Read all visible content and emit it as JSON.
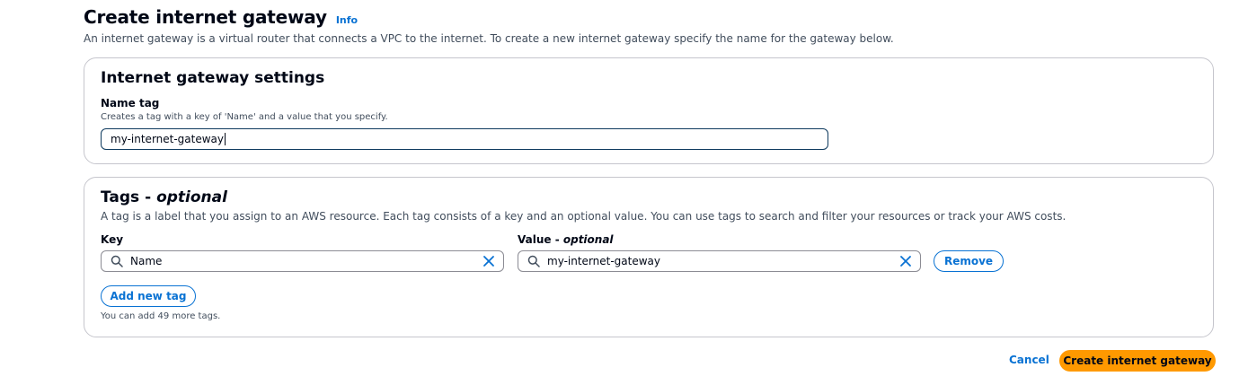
{
  "header": {
    "title": "Create internet gateway",
    "info_label": "Info",
    "description": "An internet gateway is a virtual router that connects a VPC to the internet. To create a new internet gateway specify the name for the gateway below."
  },
  "settings_panel": {
    "heading": "Internet gateway settings",
    "name_tag": {
      "label": "Name tag",
      "hint": "Creates a tag with a key of 'Name' and a value that you specify.",
      "value": "my-internet-gateway"
    }
  },
  "tags_panel": {
    "heading_prefix": "Tags - ",
    "heading_optional": "optional",
    "description": "A tag is a label that you assign to an AWS resource. Each tag consists of a key and an optional value. You can use tags to search and filter your resources or track your AWS costs.",
    "key_label": "Key",
    "value_label_prefix": "Value - ",
    "value_label_optional": "optional",
    "rows": [
      {
        "key": "Name",
        "value": "my-internet-gateway",
        "remove_label": "Remove"
      }
    ],
    "add_tag_label": "Add new tag",
    "limit_hint": "You can add 49 more tags."
  },
  "footer": {
    "cancel_label": "Cancel",
    "submit_label": "Create internet gateway"
  },
  "icons": {
    "search": "search-icon",
    "clear": "close-icon"
  },
  "colors": {
    "link": "#0972d3",
    "primary_button": "#ff9900",
    "text": "#000716",
    "border": "#c6c6cd"
  }
}
